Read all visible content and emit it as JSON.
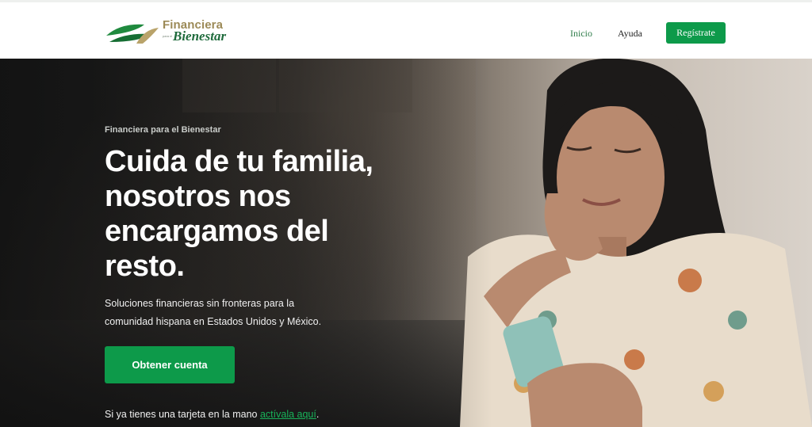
{
  "brand": {
    "line1": "Financiera",
    "small": "para el",
    "line2": "Bienestar"
  },
  "nav": {
    "home_label": "Inicio",
    "help_label": "Ayuda",
    "register_label": "Regístrate"
  },
  "hero": {
    "eyebrow": "Financiera para el Bienestar",
    "headline": "Cuida de tu familia, nosotros nos encargamos del resto.",
    "subtext": "Soluciones financieras sin fronteras para la comunidad hispana en Estados Unidos y México.",
    "cta_label": "Obtener cuenta",
    "activate_prefix": "Si ya tienes una tarjeta en la mano ",
    "activate_link": "actívala aquí",
    "activate_suffix": "."
  },
  "colors": {
    "accent_green": "#0d9a4a",
    "logo_gold": "#9c8a57",
    "logo_green": "#1f6b3c"
  },
  "icons": {
    "logo": "leaf-logo-icon"
  }
}
